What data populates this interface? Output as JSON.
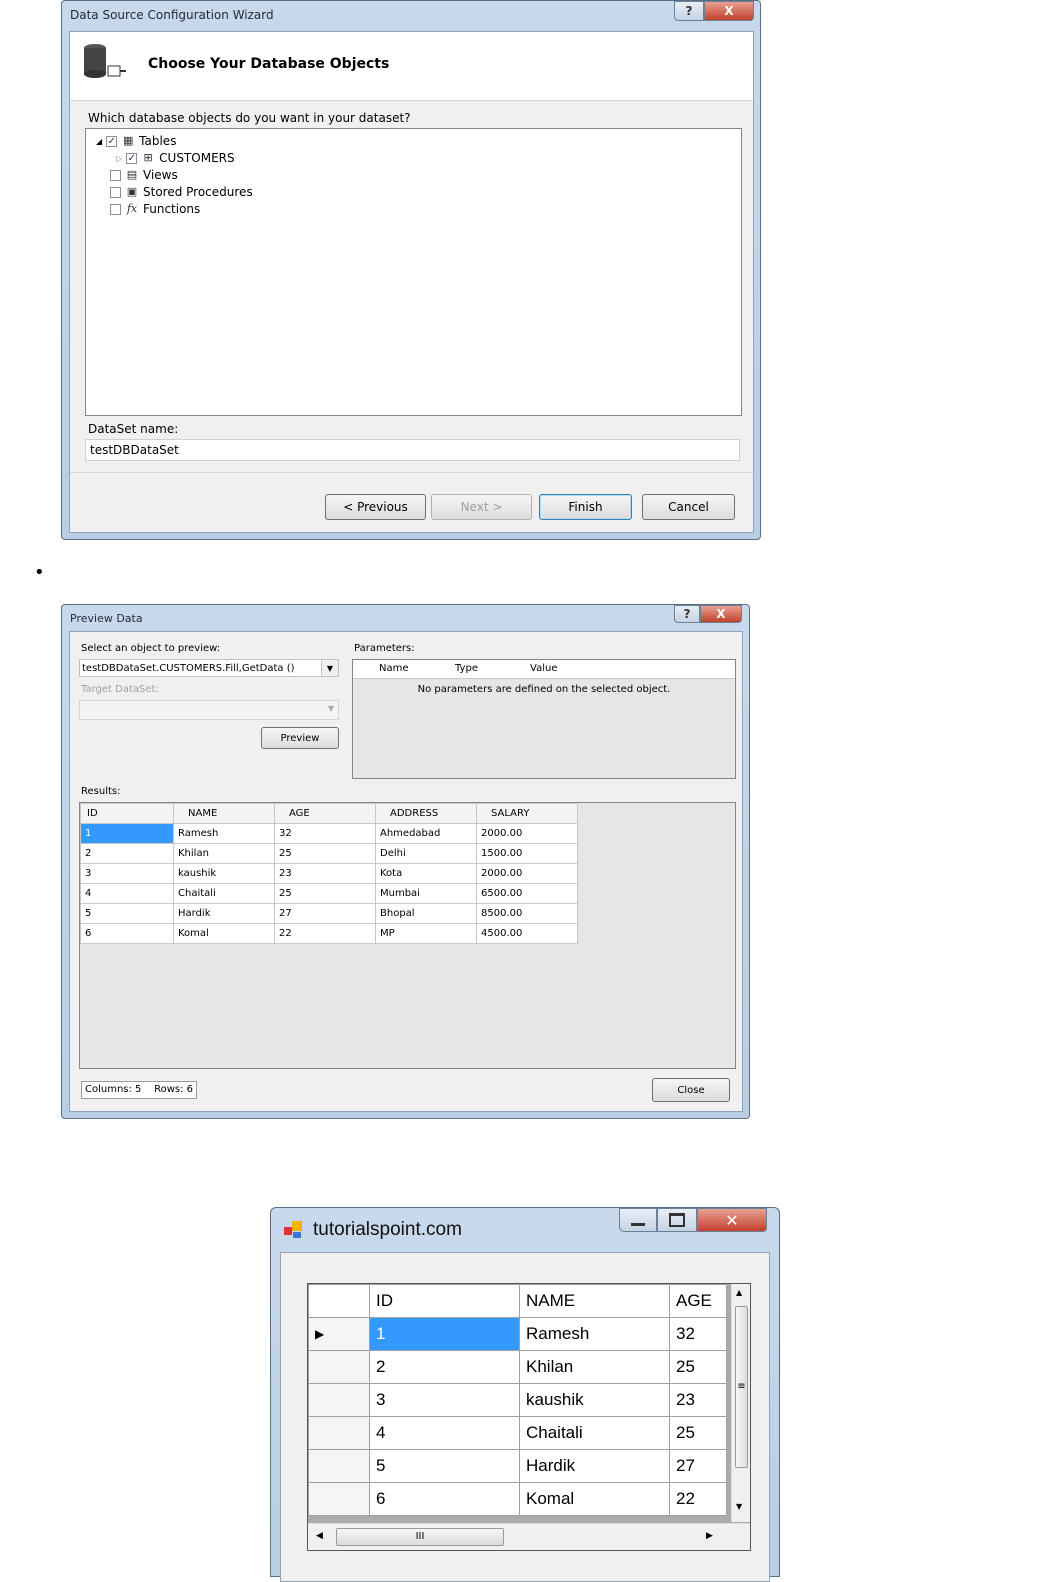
{
  "wizard": {
    "title": "Data Source Configuration Wizard",
    "help": "?",
    "close": "X",
    "heading": "Choose Your Database Objects",
    "question": "Which database objects do you want in your dataset?",
    "tree": [
      {
        "label": "Tables",
        "checked": true,
        "expanded": true
      },
      {
        "label": "CUSTOMERS",
        "checked": true
      },
      {
        "label": "Views",
        "checked": false
      },
      {
        "label": "Stored Procedures",
        "checked": false
      },
      {
        "label": "Functions",
        "checked": false
      }
    ],
    "dataset_label": "DataSet name:",
    "dataset_value": "testDBDataSet",
    "buttons": {
      "previous": "< Previous",
      "next": "Next >",
      "finish": "Finish",
      "cancel": "Cancel"
    }
  },
  "bullet": "•",
  "preview": {
    "title": "Preview Data",
    "help": "?",
    "close": "X",
    "select_label": "Select an object to preview:",
    "select_value": "testDBDataSet.CUSTOMERS.Fill,GetData ()",
    "target_label": "Target DataSet:",
    "preview_button": "Preview",
    "parameters_label": "Parameters:",
    "param_headers": [
      "Name",
      "Type",
      "Value"
    ],
    "param_empty": "No parameters are defined on the selected object.",
    "results_label": "Results:",
    "headers": [
      "ID",
      "NAME",
      "AGE",
      "ADDRESS",
      "SALARY"
    ],
    "rows": [
      [
        "1",
        "Ramesh",
        "32",
        "Ahmedabad",
        "2000.00"
      ],
      [
        "2",
        "Khilan",
        "25",
        "Delhi",
        "1500.00"
      ],
      [
        "3",
        "kaushik",
        "23",
        "Kota",
        "2000.00"
      ],
      [
        "4",
        "Chaitali",
        "25",
        "Mumbai",
        "6500.00"
      ],
      [
        "5",
        "Hardik",
        "27",
        "Bhopal",
        "8500.00"
      ],
      [
        "6",
        "Komal",
        "22",
        "MP",
        "4500.00"
      ]
    ],
    "status": "Columns: 5    Rows: 6",
    "close_button": "Close"
  },
  "form": {
    "title": "tutorialspoint.com",
    "headers": [
      "ID",
      "NAME",
      "AGE"
    ],
    "rows": [
      [
        "1",
        "Ramesh",
        "32"
      ],
      [
        "2",
        "Khilan",
        "25"
      ],
      [
        "3",
        "kaushik",
        "23"
      ],
      [
        "4",
        "Chaitali",
        "25"
      ],
      [
        "5",
        "Hardik",
        "27"
      ],
      [
        "6",
        "Komal",
        "22"
      ]
    ],
    "hscroll_grip": "III",
    "vscroll_grip": "≡"
  },
  "colors": {
    "selected_cell": "#3399ff",
    "window_frame": "#b9cde4",
    "close_red": "#c2412c"
  }
}
